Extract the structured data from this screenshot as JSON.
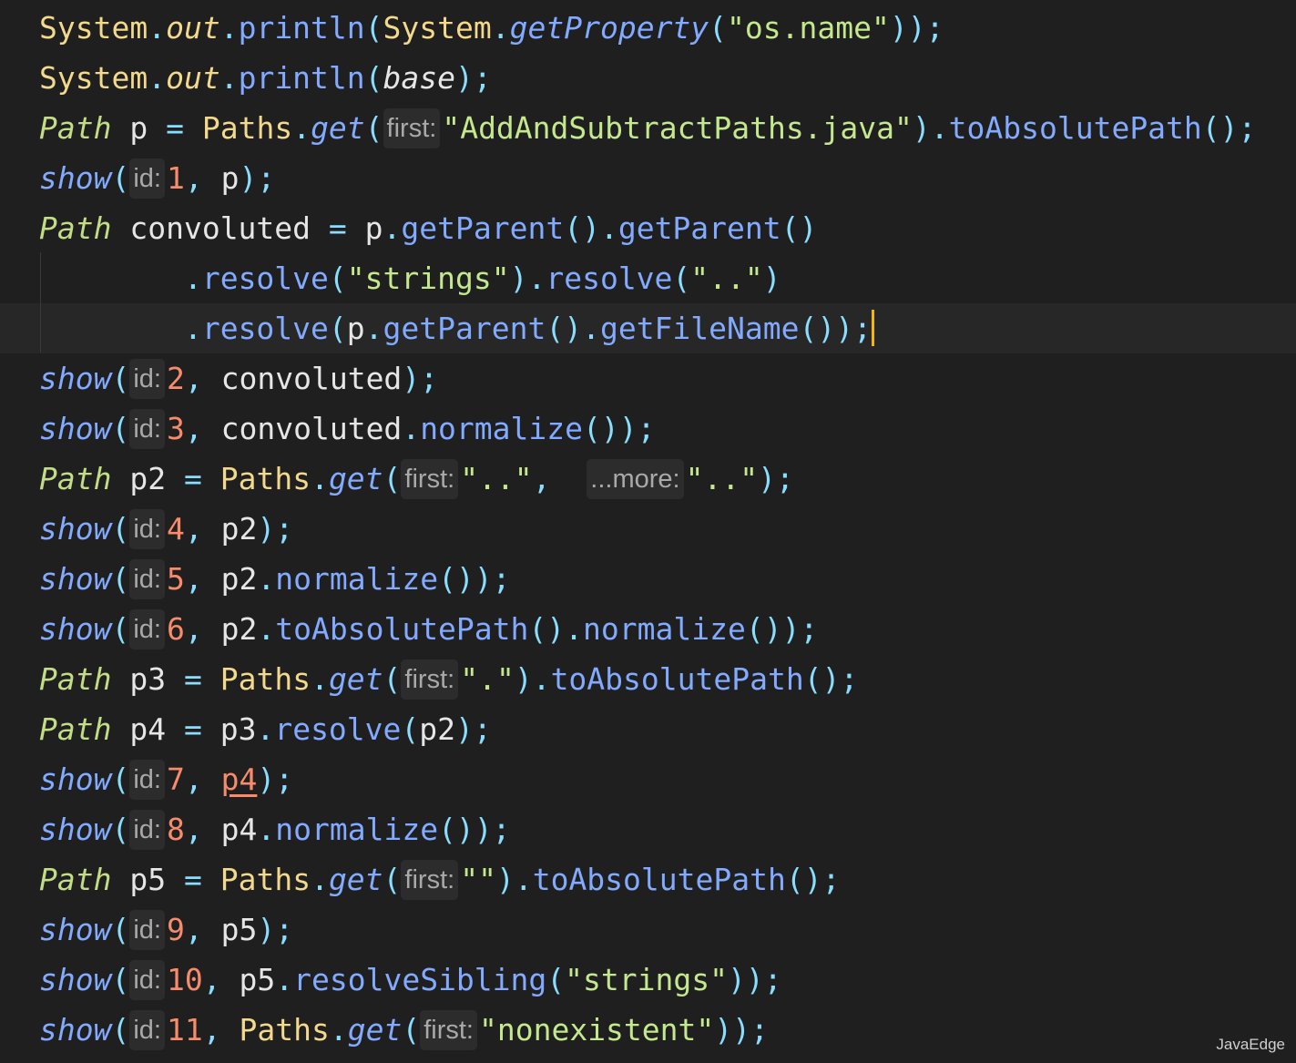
{
  "watermark": "JavaEdge",
  "lines": [
    [
      {
        "t": "System",
        "c": "cls"
      },
      {
        "t": ".",
        "c": "punc"
      },
      {
        "t": "out",
        "c": "fieldi"
      },
      {
        "t": ".",
        "c": "punc"
      },
      {
        "t": "println",
        "c": "method"
      },
      {
        "t": "(",
        "c": "punc"
      },
      {
        "t": "System",
        "c": "cls"
      },
      {
        "t": ".",
        "c": "punc"
      },
      {
        "t": "getProperty",
        "c": "methodi"
      },
      {
        "t": "(",
        "c": "punc"
      },
      {
        "t": "\"os.name\"",
        "c": "str"
      },
      {
        "t": "));",
        "c": "punc"
      }
    ],
    [
      {
        "t": "System",
        "c": "cls"
      },
      {
        "t": ".",
        "c": "punc"
      },
      {
        "t": "out",
        "c": "fieldi"
      },
      {
        "t": ".",
        "c": "punc"
      },
      {
        "t": "println",
        "c": "method"
      },
      {
        "t": "(",
        "c": "punc"
      },
      {
        "t": "base",
        "c": "vari"
      },
      {
        "t": ");",
        "c": "punc"
      }
    ],
    [
      {
        "t": "Path",
        "c": "type"
      },
      {
        "t": " p ",
        "c": "plain"
      },
      {
        "t": "=",
        "c": "op"
      },
      {
        "t": " ",
        "c": "plain"
      },
      {
        "t": "Paths",
        "c": "cls"
      },
      {
        "t": ".",
        "c": "punc"
      },
      {
        "t": "get",
        "c": "methodi"
      },
      {
        "t": "(",
        "c": "punc"
      },
      {
        "t": "first:",
        "c": "hint"
      },
      {
        "t": "\"AddAndSubtractPaths.java\"",
        "c": "str"
      },
      {
        "t": ").",
        "c": "punc"
      },
      {
        "t": "toAbsolutePath",
        "c": "method"
      },
      {
        "t": "();",
        "c": "punc"
      }
    ],
    [
      {
        "t": "show",
        "c": "methodi"
      },
      {
        "t": "(",
        "c": "punc"
      },
      {
        "t": "id:",
        "c": "hint"
      },
      {
        "t": "1",
        "c": "num"
      },
      {
        "t": ", ",
        "c": "punc"
      },
      {
        "t": "p",
        "c": "plain"
      },
      {
        "t": ");",
        "c": "punc"
      }
    ],
    [
      {
        "t": "Path",
        "c": "type"
      },
      {
        "t": " convoluted ",
        "c": "plain"
      },
      {
        "t": "=",
        "c": "op"
      },
      {
        "t": " p",
        "c": "plain"
      },
      {
        "t": ".",
        "c": "punc"
      },
      {
        "t": "getParent",
        "c": "method"
      },
      {
        "t": "().",
        "c": "punc"
      },
      {
        "t": "getParent",
        "c": "method"
      },
      {
        "t": "()",
        "c": "punc"
      }
    ],
    [
      {
        "t": "        ",
        "c": "plain"
      },
      {
        "t": ".",
        "c": "punc"
      },
      {
        "t": "resolve",
        "c": "method"
      },
      {
        "t": "(",
        "c": "punc"
      },
      {
        "t": "\"strings\"",
        "c": "str"
      },
      {
        "t": ").",
        "c": "punc"
      },
      {
        "t": "resolve",
        "c": "method"
      },
      {
        "t": "(",
        "c": "punc"
      },
      {
        "t": "\"..\"",
        "c": "str"
      },
      {
        "t": ")",
        "c": "punc"
      }
    ],
    [
      {
        "t": "        ",
        "c": "plain"
      },
      {
        "t": ".",
        "c": "punc"
      },
      {
        "t": "resolve",
        "c": "method"
      },
      {
        "t": "(",
        "c": "punc"
      },
      {
        "t": "p",
        "c": "plain"
      },
      {
        "t": ".",
        "c": "punc"
      },
      {
        "t": "getParent",
        "c": "method"
      },
      {
        "t": "().",
        "c": "punc"
      },
      {
        "t": "getFileName",
        "c": "method"
      },
      {
        "t": "());",
        "c": "punc"
      }
    ],
    [
      {
        "t": "show",
        "c": "methodi"
      },
      {
        "t": "(",
        "c": "punc"
      },
      {
        "t": "id:",
        "c": "hint"
      },
      {
        "t": "2",
        "c": "num"
      },
      {
        "t": ", ",
        "c": "punc"
      },
      {
        "t": "convoluted",
        "c": "plain"
      },
      {
        "t": ");",
        "c": "punc"
      }
    ],
    [
      {
        "t": "show",
        "c": "methodi"
      },
      {
        "t": "(",
        "c": "punc"
      },
      {
        "t": "id:",
        "c": "hint"
      },
      {
        "t": "3",
        "c": "num"
      },
      {
        "t": ", ",
        "c": "punc"
      },
      {
        "t": "convoluted",
        "c": "plain"
      },
      {
        "t": ".",
        "c": "punc"
      },
      {
        "t": "normalize",
        "c": "method"
      },
      {
        "t": "());",
        "c": "punc"
      }
    ],
    [
      {
        "t": "Path",
        "c": "type"
      },
      {
        "t": " p2 ",
        "c": "plain"
      },
      {
        "t": "=",
        "c": "op"
      },
      {
        "t": " ",
        "c": "plain"
      },
      {
        "t": "Paths",
        "c": "cls"
      },
      {
        "t": ".",
        "c": "punc"
      },
      {
        "t": "get",
        "c": "methodi"
      },
      {
        "t": "(",
        "c": "punc"
      },
      {
        "t": "first:",
        "c": "hint"
      },
      {
        "t": "\"..\"",
        "c": "str"
      },
      {
        "t": ",  ",
        "c": "punc"
      },
      {
        "t": "...more:",
        "c": "hint"
      },
      {
        "t": "\"..\"",
        "c": "str"
      },
      {
        "t": ");",
        "c": "punc"
      }
    ],
    [
      {
        "t": "show",
        "c": "methodi"
      },
      {
        "t": "(",
        "c": "punc"
      },
      {
        "t": "id:",
        "c": "hint"
      },
      {
        "t": "4",
        "c": "num"
      },
      {
        "t": ", ",
        "c": "punc"
      },
      {
        "t": "p2",
        "c": "plain"
      },
      {
        "t": ");",
        "c": "punc"
      }
    ],
    [
      {
        "t": "show",
        "c": "methodi"
      },
      {
        "t": "(",
        "c": "punc"
      },
      {
        "t": "id:",
        "c": "hint"
      },
      {
        "t": "5",
        "c": "num"
      },
      {
        "t": ", ",
        "c": "punc"
      },
      {
        "t": "p2",
        "c": "plain"
      },
      {
        "t": ".",
        "c": "punc"
      },
      {
        "t": "normalize",
        "c": "method"
      },
      {
        "t": "());",
        "c": "punc"
      }
    ],
    [
      {
        "t": "show",
        "c": "methodi"
      },
      {
        "t": "(",
        "c": "punc"
      },
      {
        "t": "id:",
        "c": "hint"
      },
      {
        "t": "6",
        "c": "num"
      },
      {
        "t": ", ",
        "c": "punc"
      },
      {
        "t": "p2",
        "c": "plain"
      },
      {
        "t": ".",
        "c": "punc"
      },
      {
        "t": "toAbsolutePath",
        "c": "method"
      },
      {
        "t": "().",
        "c": "punc"
      },
      {
        "t": "normalize",
        "c": "method"
      },
      {
        "t": "());",
        "c": "punc"
      }
    ],
    [
      {
        "t": "Path",
        "c": "type"
      },
      {
        "t": " p3 ",
        "c": "plain"
      },
      {
        "t": "=",
        "c": "op"
      },
      {
        "t": " ",
        "c": "plain"
      },
      {
        "t": "Paths",
        "c": "cls"
      },
      {
        "t": ".",
        "c": "punc"
      },
      {
        "t": "get",
        "c": "methodi"
      },
      {
        "t": "(",
        "c": "punc"
      },
      {
        "t": "first:",
        "c": "hint"
      },
      {
        "t": "\".\"",
        "c": "str"
      },
      {
        "t": ").",
        "c": "punc"
      },
      {
        "t": "toAbsolutePath",
        "c": "method"
      },
      {
        "t": "();",
        "c": "punc"
      }
    ],
    [
      {
        "t": "Path",
        "c": "type"
      },
      {
        "t": " p4 ",
        "c": "plain"
      },
      {
        "t": "=",
        "c": "op"
      },
      {
        "t": " p3",
        "c": "plain"
      },
      {
        "t": ".",
        "c": "punc"
      },
      {
        "t": "resolve",
        "c": "method"
      },
      {
        "t": "(",
        "c": "punc"
      },
      {
        "t": "p2",
        "c": "plain"
      },
      {
        "t": ");",
        "c": "punc"
      }
    ],
    [
      {
        "t": "show",
        "c": "methodi"
      },
      {
        "t": "(",
        "c": "punc"
      },
      {
        "t": "id:",
        "c": "hint"
      },
      {
        "t": "7",
        "c": "num"
      },
      {
        "t": ", ",
        "c": "punc"
      },
      {
        "t": "p4",
        "c": "warn"
      },
      {
        "t": ");",
        "c": "punc"
      }
    ],
    [
      {
        "t": "show",
        "c": "methodi"
      },
      {
        "t": "(",
        "c": "punc"
      },
      {
        "t": "id:",
        "c": "hint"
      },
      {
        "t": "8",
        "c": "num"
      },
      {
        "t": ", ",
        "c": "punc"
      },
      {
        "t": "p4",
        "c": "plain"
      },
      {
        "t": ".",
        "c": "punc"
      },
      {
        "t": "normalize",
        "c": "method"
      },
      {
        "t": "());",
        "c": "punc"
      }
    ],
    [
      {
        "t": "Path",
        "c": "type"
      },
      {
        "t": " p5 ",
        "c": "plain"
      },
      {
        "t": "=",
        "c": "op"
      },
      {
        "t": " ",
        "c": "plain"
      },
      {
        "t": "Paths",
        "c": "cls"
      },
      {
        "t": ".",
        "c": "punc"
      },
      {
        "t": "get",
        "c": "methodi"
      },
      {
        "t": "(",
        "c": "punc"
      },
      {
        "t": "first:",
        "c": "hint"
      },
      {
        "t": "\"\"",
        "c": "str"
      },
      {
        "t": ").",
        "c": "punc"
      },
      {
        "t": "toAbsolutePath",
        "c": "method"
      },
      {
        "t": "();",
        "c": "punc"
      }
    ],
    [
      {
        "t": "show",
        "c": "methodi"
      },
      {
        "t": "(",
        "c": "punc"
      },
      {
        "t": "id:",
        "c": "hint"
      },
      {
        "t": "9",
        "c": "num"
      },
      {
        "t": ", ",
        "c": "punc"
      },
      {
        "t": "p5",
        "c": "plain"
      },
      {
        "t": ");",
        "c": "punc"
      }
    ],
    [
      {
        "t": "show",
        "c": "methodi"
      },
      {
        "t": "(",
        "c": "punc"
      },
      {
        "t": "id:",
        "c": "hint"
      },
      {
        "t": "10",
        "c": "num"
      },
      {
        "t": ", ",
        "c": "punc"
      },
      {
        "t": "p5",
        "c": "plain"
      },
      {
        "t": ".",
        "c": "punc"
      },
      {
        "t": "resolveSibling",
        "c": "method"
      },
      {
        "t": "(",
        "c": "punc"
      },
      {
        "t": "\"strings\"",
        "c": "str"
      },
      {
        "t": "));",
        "c": "punc"
      }
    ],
    [
      {
        "t": "show",
        "c": "methodi"
      },
      {
        "t": "(",
        "c": "punc"
      },
      {
        "t": "id:",
        "c": "hint"
      },
      {
        "t": "11",
        "c": "num"
      },
      {
        "t": ", ",
        "c": "punc"
      },
      {
        "t": "Paths",
        "c": "cls"
      },
      {
        "t": ".",
        "c": "punc"
      },
      {
        "t": "get",
        "c": "methodi"
      },
      {
        "t": "(",
        "c": "punc"
      },
      {
        "t": "first:",
        "c": "hint"
      },
      {
        "t": "\"nonexistent\"",
        "c": "str"
      },
      {
        "t": "));",
        "c": "punc"
      }
    ]
  ]
}
